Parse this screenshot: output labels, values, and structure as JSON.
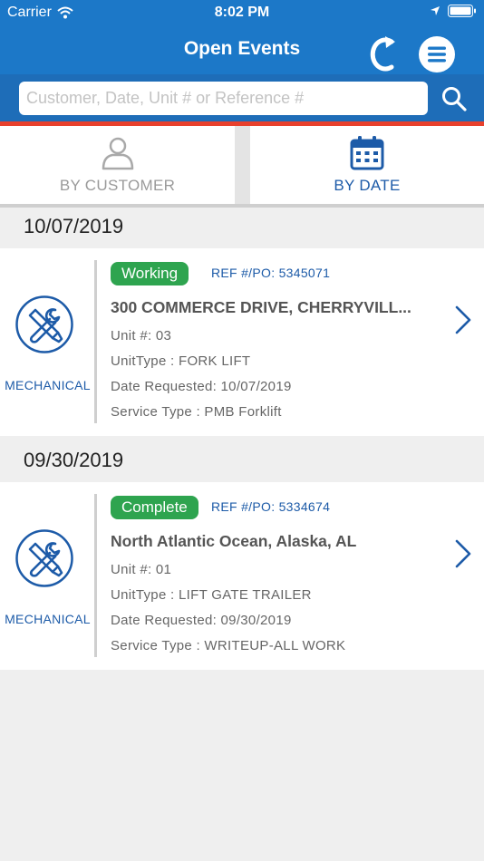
{
  "status_bar": {
    "carrier": "Carrier",
    "time": "8:02 PM"
  },
  "header": {
    "title": "Open Events",
    "refresh_icon": "refresh-icon",
    "menu_icon": "menu-icon"
  },
  "search": {
    "placeholder": "Customer, Date, Unit # or Reference #",
    "value": ""
  },
  "tabs": [
    {
      "label": "BY CUSTOMER",
      "icon": "person-icon",
      "selected": false
    },
    {
      "label": "BY DATE",
      "icon": "calendar-icon",
      "selected": true
    }
  ],
  "groups": [
    {
      "date": "10/07/2019",
      "event": {
        "category": "MECHANICAL",
        "status": "Working",
        "ref": "REF #/PO: 5345071",
        "address": "300 COMMERCE DRIVE, CHERRYVILL...",
        "unit": "Unit #: 03",
        "unit_type": "UnitType : FORK LIFT",
        "date_requested": "Date Requested: 10/07/2019",
        "service_type": "Service Type : PMB Forklift"
      }
    },
    {
      "date": "09/30/2019",
      "event": {
        "category": "MECHANICAL",
        "status": "Complete",
        "ref": "REF #/PO: 5334674",
        "address": "North Atlantic Ocean, Alaska, AL",
        "unit": "Unit #: 01",
        "unit_type": "UnitType : LIFT GATE TRAILER",
        "date_requested": "Date Requested: 09/30/2019",
        "service_type": "Service Type : WRITEUP-ALL WORK"
      }
    }
  ],
  "colors": {
    "header": "#1c78c8",
    "accent_red": "#e8402c",
    "link_blue": "#1d5ba8",
    "status_green": "#2ea44f"
  }
}
